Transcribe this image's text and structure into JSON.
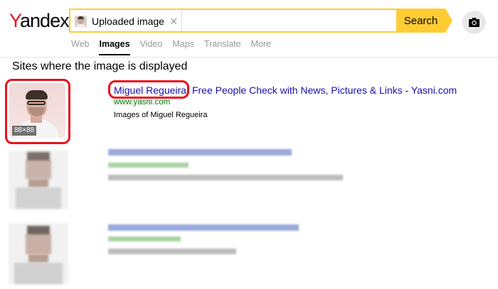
{
  "logo": {
    "first_letter": "Y",
    "rest": "andex"
  },
  "search": {
    "chip_label": "Uploaded image",
    "button_label": "Search"
  },
  "tabs": [
    {
      "label": "Web"
    },
    {
      "label": "Images"
    },
    {
      "label": "Video"
    },
    {
      "label": "Maps"
    },
    {
      "label": "Translate"
    },
    {
      "label": "More"
    }
  ],
  "active_tab": "Images",
  "section_title": "Sites where the image is displayed",
  "results": [
    {
      "thumbnail_size": "88×88",
      "title_highlight": "Miguel Regueira",
      "title_rest": "Free People Check with News, Pictures & Links - Yasni.com",
      "url": "www.yasni.com",
      "description": "Images of Miguel Regueira"
    }
  ],
  "colors": {
    "accent": "#ffcc33",
    "link": "#1a0dab",
    "url": "#007700",
    "highlight": "#e8111a"
  }
}
